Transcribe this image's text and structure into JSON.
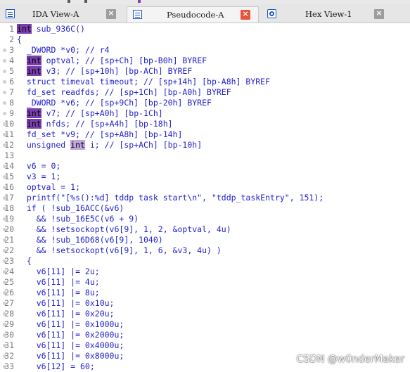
{
  "tabs": [
    {
      "label": "IDA View-A",
      "icon": "ida-view-icon",
      "active": false
    },
    {
      "label": "Pseudocode-A",
      "icon": "pseudocode-icon",
      "active": true
    },
    {
      "label": "Hex View-1",
      "icon": "hex-view-icon",
      "active": false
    }
  ],
  "tab_close_glyph": "×",
  "colors": {
    "keyword_highlight": "#7a3fae",
    "active_close": "#e8553c",
    "code_text": "#1f1fcc"
  },
  "code": {
    "lines": [
      {
        "n": "1",
        "pre": "",
        "kw": "int",
        "post": " sub_936C()"
      },
      {
        "n": "2",
        "pre": "{",
        "kw": "",
        "post": ""
      },
      {
        "n": "3",
        "pre": "  _DWORD *v0; // r4",
        "kw": "",
        "post": ""
      },
      {
        "n": "4",
        "pre": "  ",
        "kw": "int",
        "post": " optval; // [sp+Ch] [bp-B0h] BYREF"
      },
      {
        "n": "5",
        "pre": "  ",
        "kw": "int",
        "post": " v3; // [sp+10h] [bp-ACh] BYREF"
      },
      {
        "n": "6",
        "pre": "  struct timeval timeout; // [sp+14h] [bp-A8h] BYREF",
        "kw": "",
        "post": ""
      },
      {
        "n": "7",
        "pre": "  fd_set readfds; // [sp+1Ch] [bp-A0h] BYREF",
        "kw": "",
        "post": ""
      },
      {
        "n": "8",
        "pre": "  _DWORD *v6; // [sp+9Ch] [bp-20h] BYREF",
        "kw": "",
        "post": ""
      },
      {
        "n": "9",
        "pre": "  ",
        "kw": "int",
        "post": " v7; // [sp+A0h] [bp-1Ch]"
      },
      {
        "n": "10",
        "pre": "  ",
        "kw": "int",
        "post": " nfds; // [sp+A4h] [bp-18h]"
      },
      {
        "n": "11",
        "pre": "  fd_set *v9; // [sp+A8h] [bp-14h]",
        "kw": "",
        "post": ""
      },
      {
        "n": "12",
        "pre": "  unsigned ",
        "kw": "int",
        "post": " i; // [sp+ACh] [bp-10h]"
      },
      {
        "n": "13",
        "pre": "",
        "kw": "",
        "post": ""
      },
      {
        "n": "14",
        "pre": "  v6 = 0;",
        "kw": "",
        "post": ""
      },
      {
        "n": "15",
        "pre": "  v3 = 1;",
        "kw": "",
        "post": ""
      },
      {
        "n": "16",
        "pre": "  optval = 1;",
        "kw": "",
        "post": ""
      },
      {
        "n": "17",
        "pre": "  printf(\"[%s():%d] tddp task start\\n\", \"tddp_taskEntry\", 151);",
        "kw": "",
        "post": ""
      },
      {
        "n": "18",
        "pre": "  if ( !sub_16ACC(&v6)",
        "kw": "",
        "post": ""
      },
      {
        "n": "19",
        "pre": "    && !sub_16E5C(v6 + 9)",
        "kw": "",
        "post": ""
      },
      {
        "n": "20",
        "pre": "    && !setsockopt(v6[9], 1, 2, &optval, 4u)",
        "kw": "",
        "post": ""
      },
      {
        "n": "21",
        "pre": "    && !sub_16D68(v6[9], 1040)",
        "kw": "",
        "post": ""
      },
      {
        "n": "22",
        "pre": "    && !setsockopt(v6[9], 1, 6, &v3, 4u) )",
        "kw": "",
        "post": ""
      },
      {
        "n": "23",
        "pre": "  {",
        "kw": "",
        "post": ""
      },
      {
        "n": "24",
        "pre": "    v6[11] |= 2u;",
        "kw": "",
        "post": ""
      },
      {
        "n": "25",
        "pre": "    v6[11] |= 4u;",
        "kw": "",
        "post": ""
      },
      {
        "n": "26",
        "pre": "    v6[11] |= 8u;",
        "kw": "",
        "post": ""
      },
      {
        "n": "27",
        "pre": "    v6[11] |= 0x10u;",
        "kw": "",
        "post": ""
      },
      {
        "n": "28",
        "pre": "    v6[11] |= 0x20u;",
        "kw": "",
        "post": ""
      },
      {
        "n": "29",
        "pre": "    v6[11] |= 0x1000u;",
        "kw": "",
        "post": ""
      },
      {
        "n": "30",
        "pre": "    v6[11] |= 0x2000u;",
        "kw": "",
        "post": ""
      },
      {
        "n": "31",
        "pre": "    v6[11] |= 0x4000u;",
        "kw": "",
        "post": ""
      },
      {
        "n": "32",
        "pre": "    v6[11] |= 0x8000u;",
        "kw": "",
        "post": ""
      },
      {
        "n": "33",
        "pre": "    v6[12] = 60;",
        "kw": "",
        "post": ""
      }
    ]
  },
  "watermark": "CSDN @w0nderMaker"
}
